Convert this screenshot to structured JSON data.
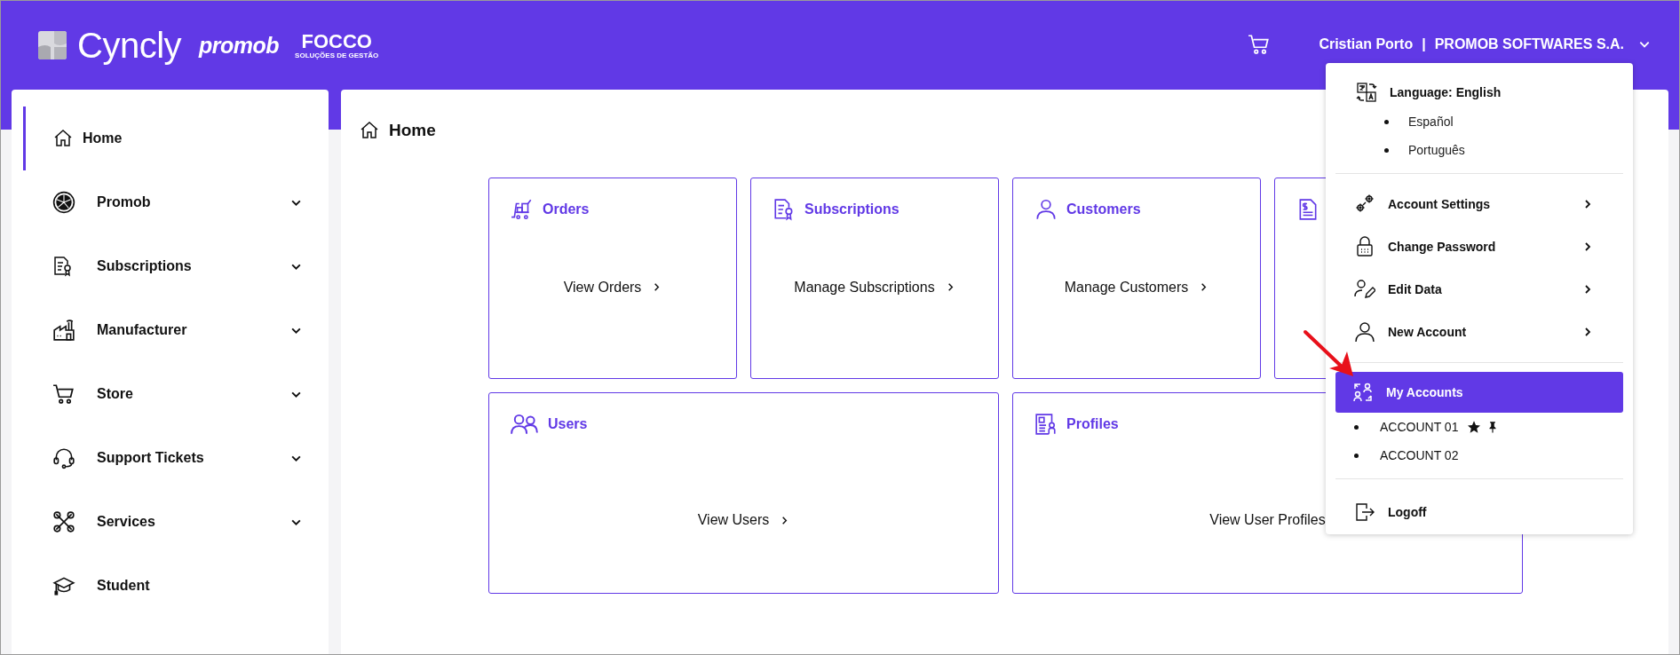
{
  "header": {
    "brand": "Cyncly",
    "partners": [
      {
        "name": "promob"
      },
      {
        "name": "FOCCO",
        "tagline": "SOLUÇÕES DE GESTÃO"
      }
    ],
    "user": "Cristian Porto",
    "separator": "|",
    "company": "PROMOB SOFTWARES S.A.",
    "menu_expanded": true
  },
  "sidebar": {
    "items": [
      {
        "label": "Home",
        "selected": true,
        "expandable": false
      },
      {
        "label": "Promob",
        "selected": false,
        "expandable": true
      },
      {
        "label": "Subscriptions",
        "selected": false,
        "expandable": true
      },
      {
        "label": "Manufacturer",
        "selected": false,
        "expandable": true
      },
      {
        "label": "Store",
        "selected": false,
        "expandable": true
      },
      {
        "label": "Support Tickets",
        "selected": false,
        "expandable": true
      },
      {
        "label": "Services",
        "selected": false,
        "expandable": true
      },
      {
        "label": "Student",
        "selected": false,
        "expandable": false
      }
    ]
  },
  "page": {
    "title": "Home",
    "cards": [
      {
        "kind": "orders",
        "title": "Orders",
        "link": "View Orders",
        "link_arrow": true,
        "wide": false
      },
      {
        "kind": "subscriptions",
        "title": "Subscriptions",
        "link": "Manage Subscriptions",
        "link_arrow": true,
        "wide": false
      },
      {
        "kind": "customers",
        "title": "Customers",
        "link": "Manage Customers",
        "link_arrow": true,
        "wide": false
      },
      {
        "kind": "billing",
        "wide": false
      },
      {
        "kind": "users",
        "title": "Users",
        "link": "View Users",
        "link_arrow": true,
        "wide": true
      },
      {
        "kind": "profiles",
        "title": "Profiles",
        "link": "View User Profiles",
        "link_arrow": false,
        "wide": true
      }
    ]
  },
  "account_menu": {
    "language": "Language: English",
    "languages": [
      "Español",
      "Português"
    ],
    "items": [
      {
        "kind": "settings",
        "label": "Account Settings"
      },
      {
        "kind": "password",
        "label": "Change Password"
      },
      {
        "kind": "edit",
        "label": "Edit Data"
      },
      {
        "kind": "new",
        "label": "New Account"
      }
    ],
    "my_accounts": {
      "label": "My Accounts",
      "selected": true
    },
    "accounts": [
      {
        "name": "ACCOUNT 01",
        "favorite": true,
        "pinned": true
      },
      {
        "name": "ACCOUNT 02",
        "favorite": false,
        "pinned": false
      }
    ],
    "logoff": "Logoff"
  }
}
